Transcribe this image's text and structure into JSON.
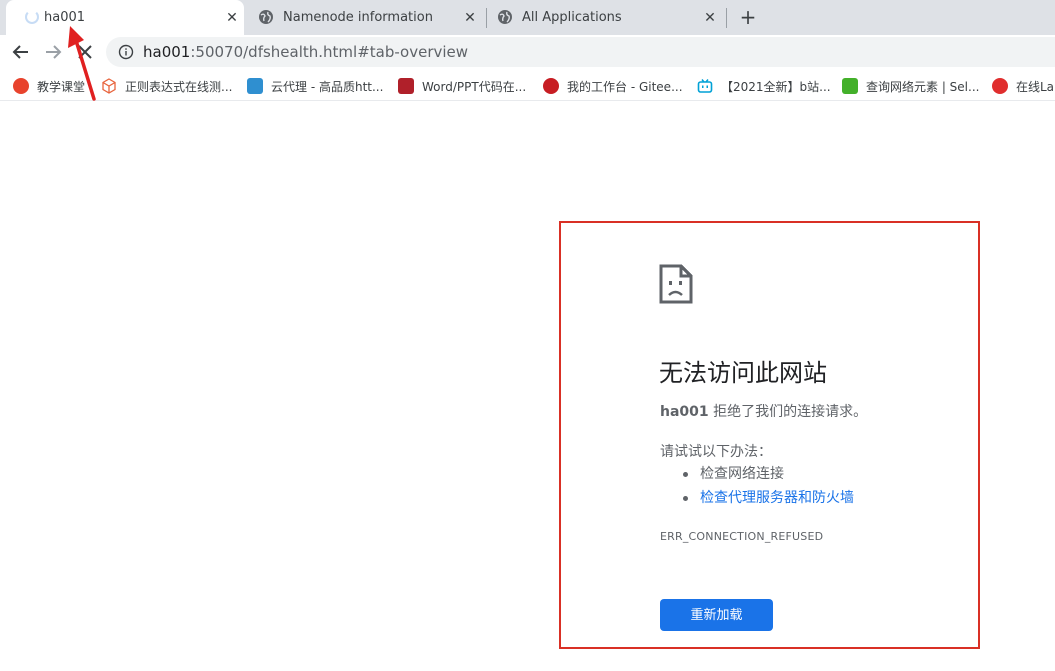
{
  "tabs": [
    {
      "title": "ha001",
      "icon": "loading-spinner",
      "active": true
    },
    {
      "title": "Namenode information",
      "icon": "globe-icon",
      "active": false
    },
    {
      "title": "All Applications",
      "icon": "globe-icon",
      "active": false
    }
  ],
  "new_tab_label": "+",
  "close_glyph": "✕",
  "address_bar": {
    "host": "ha001",
    "path": ":50070/dfshealth.html#tab-overview"
  },
  "bookmarks": [
    {
      "label": "教学课堂",
      "icon": "toutiao-icon",
      "color": "#e8432d"
    },
    {
      "label": "正则表达式在线测...",
      "icon": "cube-icon",
      "color": "#e8643d"
    },
    {
      "label": "云代理 - 高品质htt...",
      "icon": "cloud-proxy-icon",
      "color": "#2f8fd0"
    },
    {
      "label": "Word/PPT代码在...",
      "icon": "word-logo-icon",
      "color": "#b0202a"
    },
    {
      "label": "我的工作台 - Gitee...",
      "icon": "gitee-icon",
      "color": "#c71d23"
    },
    {
      "label": "【2021全新】b站...",
      "icon": "bilibili-icon",
      "color": "#00a1d6"
    },
    {
      "label": "查询网络元素 | Sel...",
      "icon": "selenium-icon",
      "color": "#43b02a"
    },
    {
      "label": "在线La",
      "icon": "latex-icon",
      "color": "#e02e2e"
    }
  ],
  "error_page": {
    "title": "无法访问此网站",
    "host": "ha001",
    "message": "拒绝了我们的连接请求。",
    "try_label": "请试试以下办法：",
    "suggestions": [
      {
        "text": "检查网络连接",
        "link": false
      },
      {
        "text": "检查代理服务器和防火墙",
        "link": true
      }
    ],
    "code": "ERR_CONNECTION_REFUSED",
    "reload_label": "重新加载"
  },
  "colors": {
    "annotation_red": "#d93025",
    "primary_blue": "#1a73e8"
  }
}
